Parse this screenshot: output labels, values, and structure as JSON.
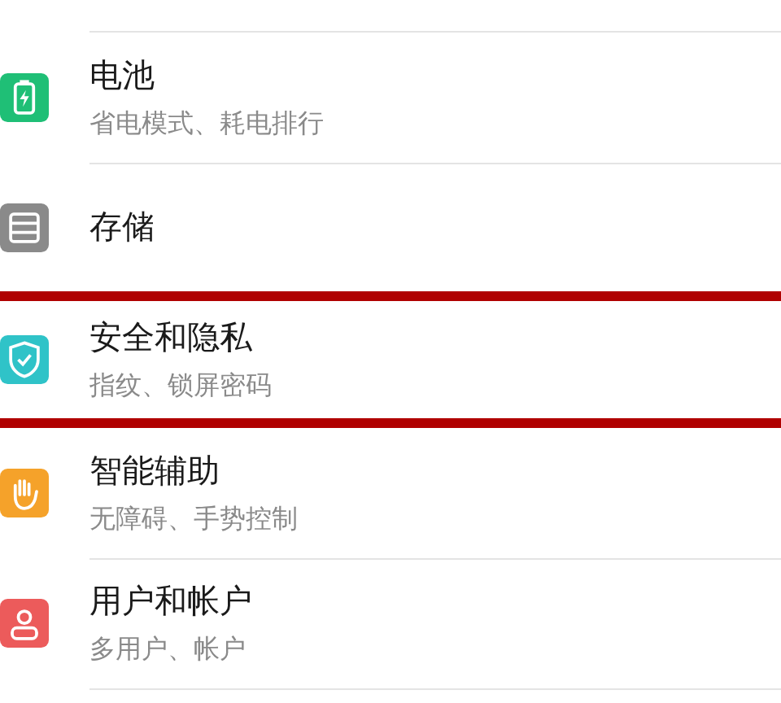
{
  "items": [
    {
      "title": "电池",
      "subtitle": "省电模式、耗电排行",
      "kind": "battery",
      "color": "#1fbf76",
      "highlighted": false
    },
    {
      "title": "存储",
      "kind": "storage",
      "color": "#8a8a8a",
      "highlighted": false
    },
    {
      "title": "安全和隐私",
      "subtitle": "指纹、锁屏密码",
      "kind": "shield",
      "color": "#2fc3c8",
      "highlighted": true
    },
    {
      "title": "智能辅助",
      "subtitle": "无障碍、手势控制",
      "kind": "hand",
      "color": "#f5a22a",
      "highlighted": false
    },
    {
      "title": "用户和帐户",
      "subtitle": "多用户、帐户",
      "kind": "user",
      "color": "#ec5b5b",
      "highlighted": false
    }
  ]
}
